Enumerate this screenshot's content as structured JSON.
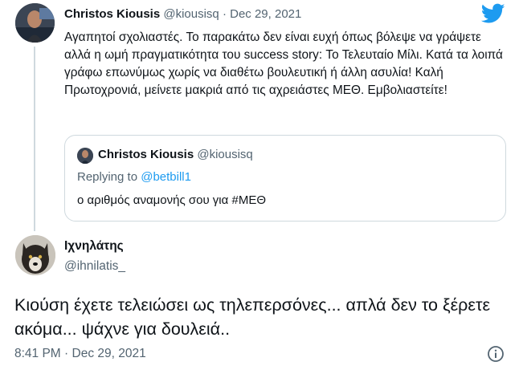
{
  "parent_tweet": {
    "author_name": "Christos Kiousis",
    "handle": "@kiousisq",
    "separator": "·",
    "date": "Dec 29, 2021",
    "text": "Αγαπητοί σχολιαστές. Το παρακάτω δεν είναι ευχή όπως βόλεψε να γράψετε αλλά η ωμή πραγματικότητα του success story: Το Τελευταίο Μίλι. Κατά τα λοιπά γράφω επωνύμως χωρίς να διαθέτω βουλευτική ή άλλη ασυλία! Καλή Πρωτοχρονιά, μείνετε μακριά από τις αχρειάστες ΜΕΘ. Εμβολιαστείτε!"
  },
  "quoted_tweet": {
    "author_name": "Christos Kiousis",
    "handle": "@kiousisq",
    "replying_to_label": "Replying to",
    "replying_to_handle": "@betbill1",
    "text": "ο αριθμός αναμονής σου για #ΜΕΘ"
  },
  "main_tweet": {
    "author_name": "Ιχνηλάτης",
    "handle": "@ihnilatis_",
    "text": "Κιούση έχετε τελειώσει ως τηλεπερσόνες... απλά δεν το ξέρετε ακόμα... ψάχνε για δουλειά..",
    "time": "8:41 PM",
    "separator": "·",
    "date": "Dec 29, 2021"
  },
  "icons": {
    "brand": "twitter-bird-icon",
    "info": "info-icon"
  },
  "colors": {
    "brand_blue": "#1d9bf0",
    "text_primary": "#0f1419",
    "text_secondary": "#536471",
    "border": "#cfd9de"
  }
}
